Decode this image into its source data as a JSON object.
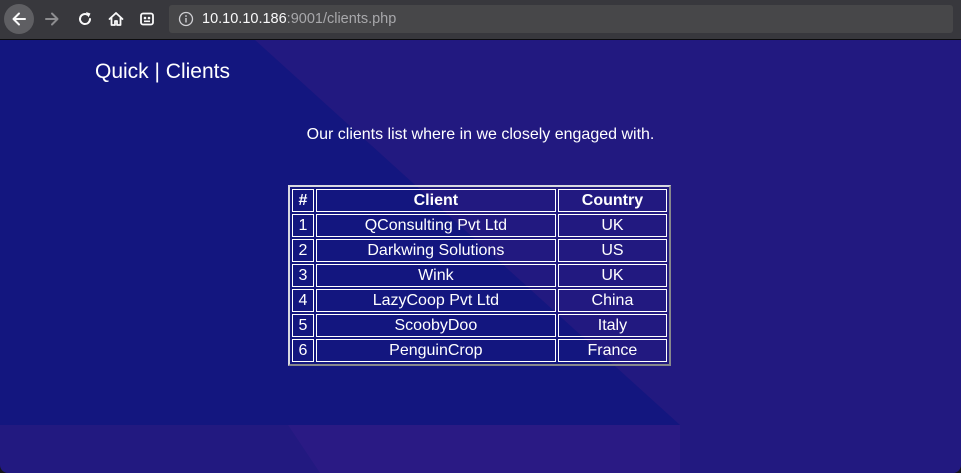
{
  "browser": {
    "url_host": "10.10.10.186",
    "url_rest": ":9001/clients.php"
  },
  "page": {
    "title": "Quick | Clients",
    "intro": "Our clients list where in we closely engaged with."
  },
  "table": {
    "headers": [
      "#",
      "Client",
      "Country"
    ],
    "rows": [
      [
        "1",
        "QConsulting Pvt Ltd",
        "UK"
      ],
      [
        "2",
        "Darkwing Solutions",
        "US"
      ],
      [
        "3",
        "Wink",
        "UK"
      ],
      [
        "4",
        "LazyCoop Pvt Ltd",
        "China"
      ],
      [
        "5",
        "ScoobyDoo",
        "Italy"
      ],
      [
        "6",
        "PenguinCrop",
        "France"
      ]
    ]
  },
  "colors": {
    "page_background": "#221980",
    "page_shape_dark": "#13167f",
    "chrome": "#38383d",
    "urlbar": "#474749"
  },
  "icons": [
    "back-arrow-icon",
    "forward-arrow-icon",
    "reload-icon",
    "home-icon",
    "extension-icon",
    "info-icon"
  ]
}
